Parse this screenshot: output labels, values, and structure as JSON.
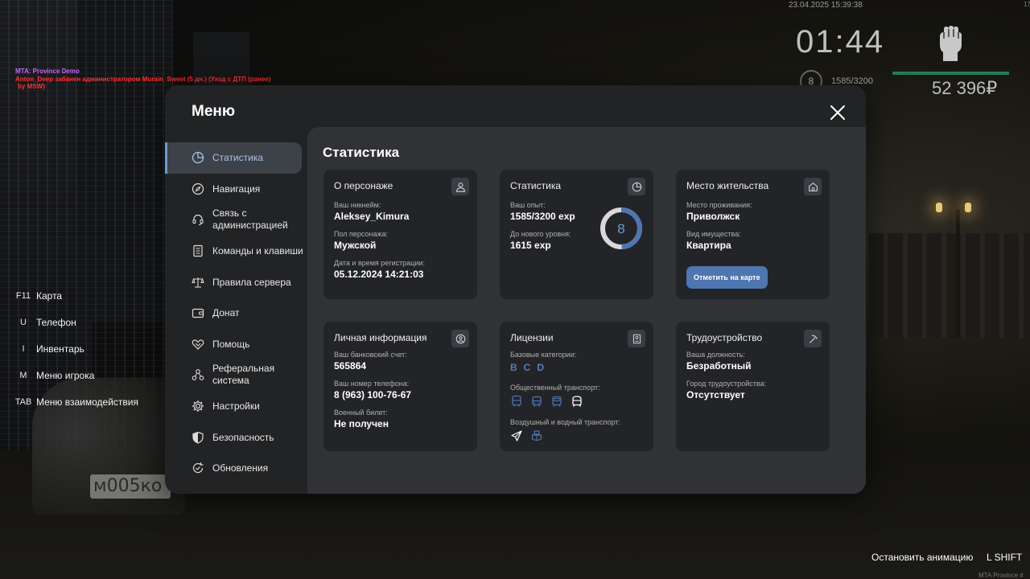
{
  "hud": {
    "server_msg_line1": "MTA: Province Demo",
    "server_msg_line2": "Anton_Deep забанен администратором Murain_Sweet (5 дн.) (Уход с ДТП (ранее)",
    "server_msg_line3": "by MSW)",
    "datetime": "23.04.2025 15:39:38",
    "clock": "01:44",
    "level": "8",
    "exp": "1585/3200",
    "money": "52 396₽",
    "corner": "17",
    "health_fraction": 1.0,
    "fist_icon": "fist-icon"
  },
  "keys": [
    {
      "key": "F11",
      "action": "Карта"
    },
    {
      "key": "U",
      "action": "Телефон"
    },
    {
      "key": "I",
      "action": "Инвентарь"
    },
    {
      "key": "M",
      "action": "Меню игрока"
    },
    {
      "key": "TAB",
      "action": "Меню взаимодействия"
    }
  ],
  "bottom": {
    "anim_hint": "Остановить анимацию",
    "anim_key": "L SHIFT",
    "watermark": "MTA Province #"
  },
  "backdrop": {
    "plate": "м005ко"
  },
  "menu": {
    "title": "Меню",
    "nav": [
      {
        "label": "Статистика",
        "icon": "pie-chart-icon",
        "active": true
      },
      {
        "label": "Навигация",
        "icon": "compass-icon"
      },
      {
        "label": "Связь с администрацией",
        "icon": "headset-icon"
      },
      {
        "label": "Команды и клавиши",
        "icon": "document-icon"
      },
      {
        "label": "Правила сервера",
        "icon": "scales-icon"
      },
      {
        "label": "Донат",
        "icon": "wallet-icon"
      },
      {
        "label": "Помощь",
        "icon": "handshake-icon"
      },
      {
        "label": "Реферальная система",
        "icon": "referral-icon"
      },
      {
        "label": "Настройки",
        "icon": "gear-icon"
      },
      {
        "label": "Безопасность",
        "icon": "shield-icon"
      },
      {
        "label": "Обновления",
        "icon": "refresh-icon"
      }
    ],
    "accent": "#6d9ad6"
  },
  "stats": {
    "title": "Статистика",
    "character": {
      "title": "О персонаже",
      "nick_label": "Ваш никнейм:",
      "nick": "Aleksey_Kimura",
      "gender_label": "Пол персонажа:",
      "gender": "Мужской",
      "reg_label": "Дата и время регистрации:",
      "reg": "05.12.2024 14:21:03"
    },
    "statistics": {
      "title": "Статистика",
      "exp_label": "Ваш опыт:",
      "exp": "1585/3200 exp",
      "next_label": "До нового уровня:",
      "next": "1615 exp",
      "level": "8",
      "progress": 0.495
    },
    "residence": {
      "title": "Место жительства",
      "place_label": "Место проживания:",
      "place": "Приволжск",
      "type_label": "Вид имущества:",
      "type": "Квартира",
      "button": "Отметить на карте"
    },
    "personal": {
      "title": "Личная информация",
      "bank_label": "Ваш банковский счет:",
      "bank": "565864",
      "phone_label": "Ваш номер телефона:",
      "phone": "8 (963) 100-76-67",
      "military_label": "Военный билет:",
      "military": "Не получен"
    },
    "licenses": {
      "title": "Лицензии",
      "base_label": "Базовые категории:",
      "base": [
        "B",
        "C",
        "D"
      ],
      "public_label": "Общественный транспорт:",
      "air_label": "Воздушный и водный транспорт:"
    },
    "employment": {
      "title": "Трудоустройство",
      "position_label": "Ваша должность:",
      "position": "Безработный",
      "city_label": "Город трудоустройства:",
      "city": "Отсутствует"
    }
  }
}
